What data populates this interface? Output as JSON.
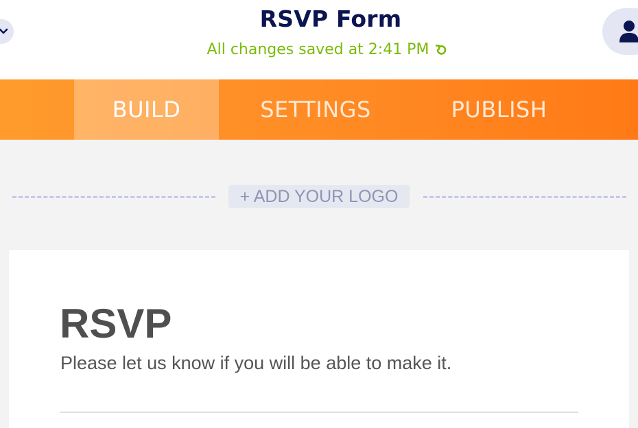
{
  "header": {
    "title": "RSVP Form",
    "save_status": "All changes saved at 2:41 PM",
    "left_toggle_icon": "chevron-down-icon",
    "refresh_icon": "refresh-icon",
    "avatar_icon": "user-icon"
  },
  "tabs": [
    {
      "label": "BUILD",
      "active": true
    },
    {
      "label": "SETTINGS",
      "active": false
    },
    {
      "label": "PUBLISH",
      "active": false
    }
  ],
  "logo": {
    "add_label": "+ ADD YOUR LOGO"
  },
  "form": {
    "heading": "RSVP",
    "subheading": "Please let us know if you will be able to make it."
  },
  "colors": {
    "title": "#0a1551",
    "save_status": "#78bb07",
    "tab_gradient_start": "#ff9b2d",
    "tab_gradient_end": "#ff7a16",
    "background": "#f3f3f4"
  }
}
